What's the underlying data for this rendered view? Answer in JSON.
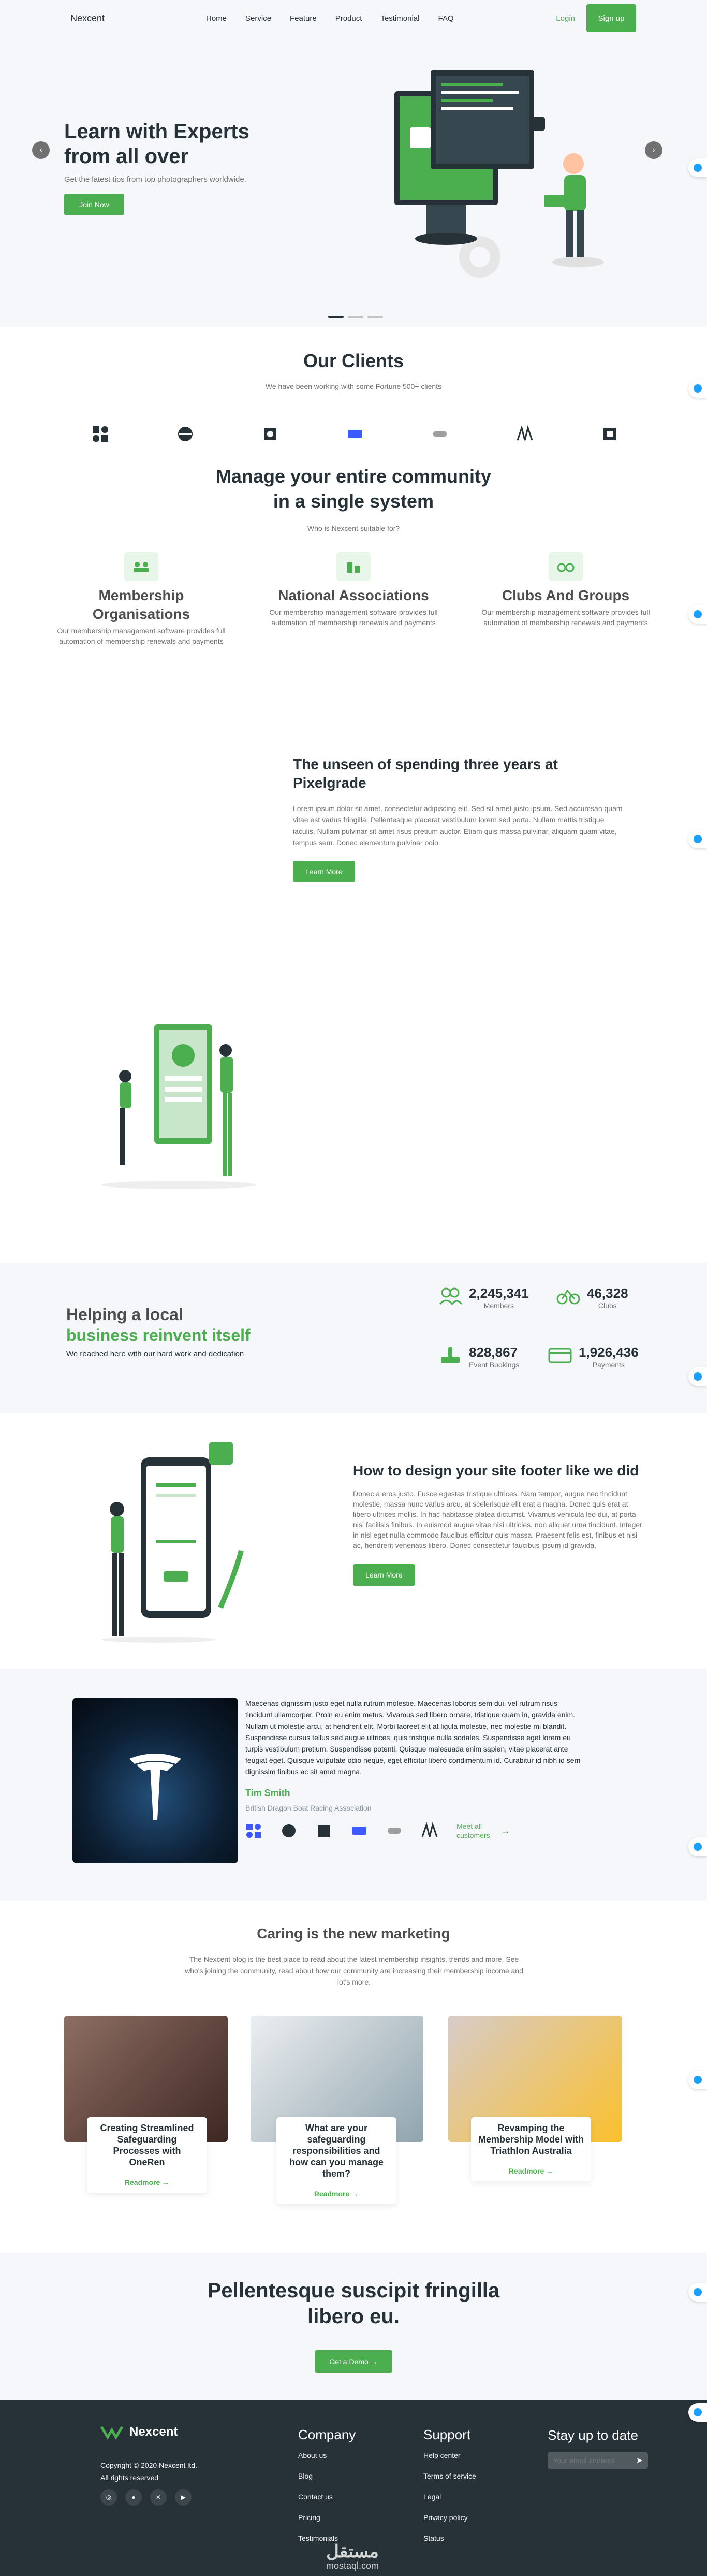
{
  "nav": {
    "logo": "Nexcent",
    "links": [
      "Home",
      "Service",
      "Feature",
      "Product",
      "Testimonial",
      "FAQ"
    ],
    "login": "Login",
    "signup": "Sign up"
  },
  "hero": {
    "title": "Learn with Experts from all over",
    "subtitle": "Get the latest tips from top photographers worldwide.",
    "cta": "Join Now",
    "prev": "‹",
    "next": "›"
  },
  "clients": {
    "title": "Our Clients",
    "subtitle": "We have been working with some Fortune 500+ clients"
  },
  "community": {
    "title_line1": "Manage your entire community",
    "title_line2": "in a single system",
    "subtitle": "Who is Nexcent suitable for?",
    "items": [
      {
        "title": "Membership Organisations",
        "text": "Our membership management software provides full automation of membership renewals and payments"
      },
      {
        "title": "National Associations",
        "text": "Our membership management software provides full automation of membership renewals and payments"
      },
      {
        "title": "Clubs And Groups",
        "text": "Our membership management software provides full automation of membership renewals and payments"
      }
    ]
  },
  "unseen": {
    "title": "The unseen of spending three years at Pixelgrade",
    "text": "Lorem ipsum dolor sit amet, consectetur adipiscing elit. Sed sit amet justo ipsum. Sed accumsan quam vitae est varius fringilla. Pellentesque placerat vestibulum lorem sed porta. Nullam mattis tristique iaculis. Nullam pulvinar sit amet risus pretium auctor. Etiam quis massa pulvinar, aliquam quam vitae, tempus sem. Donec elementum pulvinar odio.",
    "cta": "Learn More"
  },
  "stats": {
    "title_line1": "Helping a local",
    "title_line2": "business reinvent itself",
    "subtitle": "We reached here with our hard work and dedication",
    "items": [
      {
        "value": "2,245,341",
        "label": "Members"
      },
      {
        "value": "46,328",
        "label": "Clubs"
      },
      {
        "value": "828,867",
        "label": "Event Bookings"
      },
      {
        "value": "1,926,436",
        "label": "Payments"
      }
    ]
  },
  "footer_design": {
    "title": "How to design your site footer like we did",
    "text": "Donec a eros justo. Fusce egestas tristique ultrices. Nam tempor, augue nec tincidunt molestie, massa nunc varius arcu, at scelerisque elit erat a magna. Donec quis erat at libero ultrices mollis. In hac habitasse platea dictumst. Vivamus vehicula leo dui, at porta nisi facilisis finibus. In euismod augue vitae nisi ultricies, non aliquet urna tincidunt. Integer in nisi eget nulla commodo faucibus efficitur quis massa. Praesent felis est, finibus et nisi ac, hendrerit venenatis libero. Donec consectetur faucibus ipsum id gravida.",
    "cta": "Learn More"
  },
  "testimonial": {
    "quote": "Maecenas dignissim justo eget nulla rutrum molestie. Maecenas lobortis sem dui, vel rutrum risus tincidunt ullamcorper. Proin eu enim metus. Vivamus sed libero ornare, tristique quam in, gravida enim. Nullam ut molestie arcu, at hendrerit elit. Morbi laoreet elit at ligula molestie, nec molestie mi blandit. Suspendisse cursus tellus sed augue ultrices, quis tristique nulla sodales. Suspendisse eget lorem eu turpis vestibulum pretium. Suspendisse potenti. Quisque malesuada enim sapien, vitae placerat ante feugiat eget. Quisque vulputate odio neque, eget efficitur libero condimentum id. Curabitur id nibh id sem dignissim finibus ac sit amet magna.",
    "name": "Tim Smith",
    "org": "British Dragon Boat Racing Association",
    "more": "Meet all customers"
  },
  "blog": {
    "title": "Caring is the new marketing",
    "text": "The Nexcent blog is the best place to read about the latest membership insights, trends and more. See who's joining the community, read about how our community are increasing their membership income and lot's more.",
    "posts": [
      {
        "title": "Creating Streamlined Safeguarding Processes with OneRen",
        "cta": "Readmore"
      },
      {
        "title": "What are your safeguarding responsibilities and how can you manage them?",
        "cta": "Readmore"
      },
      {
        "title": "Revamping the Membership Model with Triathlon Australia",
        "cta": "Readmore"
      }
    ]
  },
  "cta": {
    "title_line1": "Pellentesque suscipit fringilla",
    "title_line2": "libero eu.",
    "button": "Get a Demo"
  },
  "footer": {
    "brand": "Nexcent",
    "copyright": "Copyright © 2020 Nexcent ltd.",
    "rights": "All rights reserved",
    "company_title": "Company",
    "company": [
      "About us",
      "Blog",
      "Contact us",
      "Pricing",
      "Testimonials"
    ],
    "support_title": "Support",
    "support": [
      "Help center",
      "Terms of service",
      "Legal",
      "Privacy policy",
      "Status"
    ],
    "stay_title": "Stay up to date",
    "email_placeholder": "Your email address",
    "watermark": "مستقل",
    "watermark_url": "mostaql.com"
  },
  "colors": {
    "primary": "#4caf4f",
    "dark": "#263238",
    "grey": "#717171",
    "silver": "#f5f7fa"
  }
}
